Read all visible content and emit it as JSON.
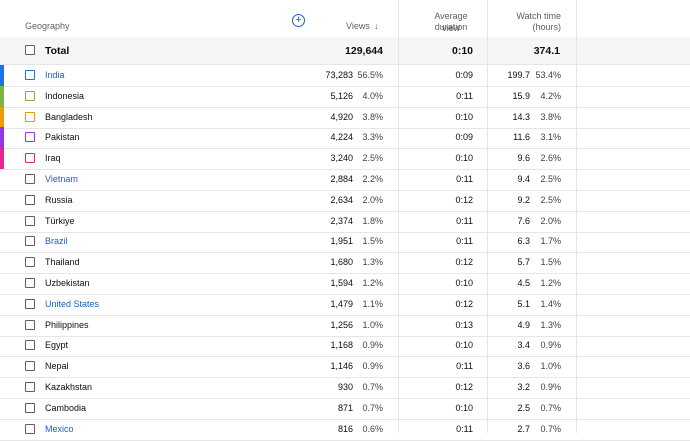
{
  "header": {
    "geography": "Geography",
    "views": "Views",
    "avg_view_duration_line1": "Average view",
    "avg_view_duration_line2": "duration",
    "watch_time_line1": "Watch time",
    "watch_time_line2": "(hours)"
  },
  "total": {
    "label": "Total",
    "views": "129,644",
    "avg": "0:10",
    "watch": "374.1"
  },
  "rows": [
    {
      "name": "India",
      "views": "73,283",
      "views_pct": "56.5%",
      "avg": "0:09",
      "watch": "199.7",
      "watch_pct": "53.4%",
      "link": true,
      "color": "#1a73e8",
      "checkbox_color": "#1a73e8"
    },
    {
      "name": "Indonesia",
      "views": "5,126",
      "views_pct": "4.0%",
      "avg": "0:11",
      "watch": "15.9",
      "watch_pct": "4.2%",
      "link": false,
      "color": "#7cb342",
      "checkbox_color": "#7cb342"
    },
    {
      "name": "Bangladesh",
      "views": "4,920",
      "views_pct": "3.8%",
      "avg": "0:10",
      "watch": "14.3",
      "watch_pct": "3.8%",
      "link": false,
      "color": "#f29900",
      "checkbox_color": "#f29900"
    },
    {
      "name": "Pakistan",
      "views": "4,224",
      "views_pct": "3.3%",
      "avg": "0:09",
      "watch": "11.6",
      "watch_pct": "3.1%",
      "link": false,
      "color": "#9334e6",
      "checkbox_color": "#9334e6"
    },
    {
      "name": "Iraq",
      "views": "3,240",
      "views_pct": "2.5%",
      "avg": "0:10",
      "watch": "9.6",
      "watch_pct": "2.6%",
      "link": false,
      "color": "#e52592",
      "checkbox_color": "#e52592"
    },
    {
      "name": "Vietnam",
      "views": "2,884",
      "views_pct": "2.2%",
      "avg": "0:11",
      "watch": "9.4",
      "watch_pct": "2.5%",
      "link": true
    },
    {
      "name": "Russia",
      "views": "2,634",
      "views_pct": "2.0%",
      "avg": "0:12",
      "watch": "9.2",
      "watch_pct": "2.5%",
      "link": false
    },
    {
      "name": "Türkiye",
      "views": "2,374",
      "views_pct": "1.8%",
      "avg": "0:11",
      "watch": "7.6",
      "watch_pct": "2.0%",
      "link": false
    },
    {
      "name": "Brazil",
      "views": "1,951",
      "views_pct": "1.5%",
      "avg": "0:11",
      "watch": "6.3",
      "watch_pct": "1.7%",
      "link": true
    },
    {
      "name": "Thailand",
      "views": "1,680",
      "views_pct": "1.3%",
      "avg": "0:12",
      "watch": "5.7",
      "watch_pct": "1.5%",
      "link": false
    },
    {
      "name": "Uzbekistan",
      "views": "1,594",
      "views_pct": "1.2%",
      "avg": "0:10",
      "watch": "4.5",
      "watch_pct": "1.2%",
      "link": false
    },
    {
      "name": "United States",
      "views": "1,479",
      "views_pct": "1.1%",
      "avg": "0:12",
      "watch": "5.1",
      "watch_pct": "1.4%",
      "link": true
    },
    {
      "name": "Philippines",
      "views": "1,256",
      "views_pct": "1.0%",
      "avg": "0:13",
      "watch": "4.9",
      "watch_pct": "1.3%",
      "link": false
    },
    {
      "name": "Egypt",
      "views": "1,168",
      "views_pct": "0.9%",
      "avg": "0:10",
      "watch": "3.4",
      "watch_pct": "0.9%",
      "link": false
    },
    {
      "name": "Nepal",
      "views": "1,146",
      "views_pct": "0.9%",
      "avg": "0:11",
      "watch": "3.6",
      "watch_pct": "1.0%",
      "link": false
    },
    {
      "name": "Kazakhstan",
      "views": "930",
      "views_pct": "0.7%",
      "avg": "0:12",
      "watch": "3.2",
      "watch_pct": "0.9%",
      "link": false
    },
    {
      "name": "Cambodia",
      "views": "871",
      "views_pct": "0.7%",
      "avg": "0:10",
      "watch": "2.5",
      "watch_pct": "0.7%",
      "link": false
    },
    {
      "name": "Mexico",
      "views": "816",
      "views_pct": "0.6%",
      "avg": "0:11",
      "watch": "2.7",
      "watch_pct": "0.7%",
      "link": true
    }
  ],
  "colors": {
    "link": "#1a5fd0",
    "border": "#e6e6e6",
    "total_bg": "#f6f6f6"
  },
  "icons": {
    "add_metric": "plus-circle-icon",
    "sort": "arrow-down-icon"
  }
}
